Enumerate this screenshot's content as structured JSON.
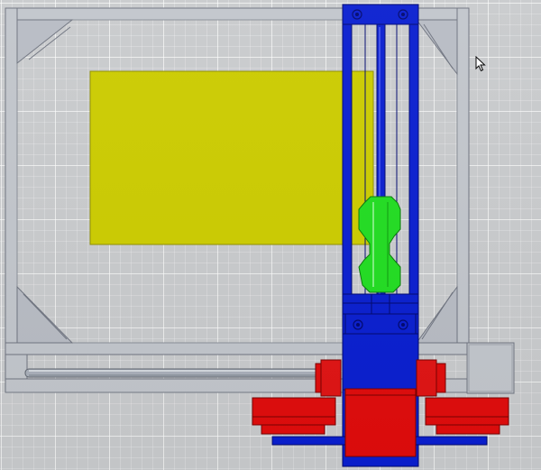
{
  "viewport": {
    "kind": "3d-cad-viewport",
    "view": "top"
  },
  "colors": {
    "background": "#c9cbcd",
    "frame_fill": "#bfc3ca",
    "frame_stroke": "#6f7480",
    "bed": "#cccc00",
    "bed_stroke": "#8f8f00",
    "carriage": "#0a1fd0",
    "carriage_stroke": "#000870",
    "motor": "#e00c0c",
    "motor_stroke": "#7a0000",
    "coupler": "#22dd22",
    "coupler_stroke": "#0a7a0a",
    "rod": "#9aa2ad"
  },
  "icons": {
    "cursor": "mouse-pointer-icon"
  }
}
